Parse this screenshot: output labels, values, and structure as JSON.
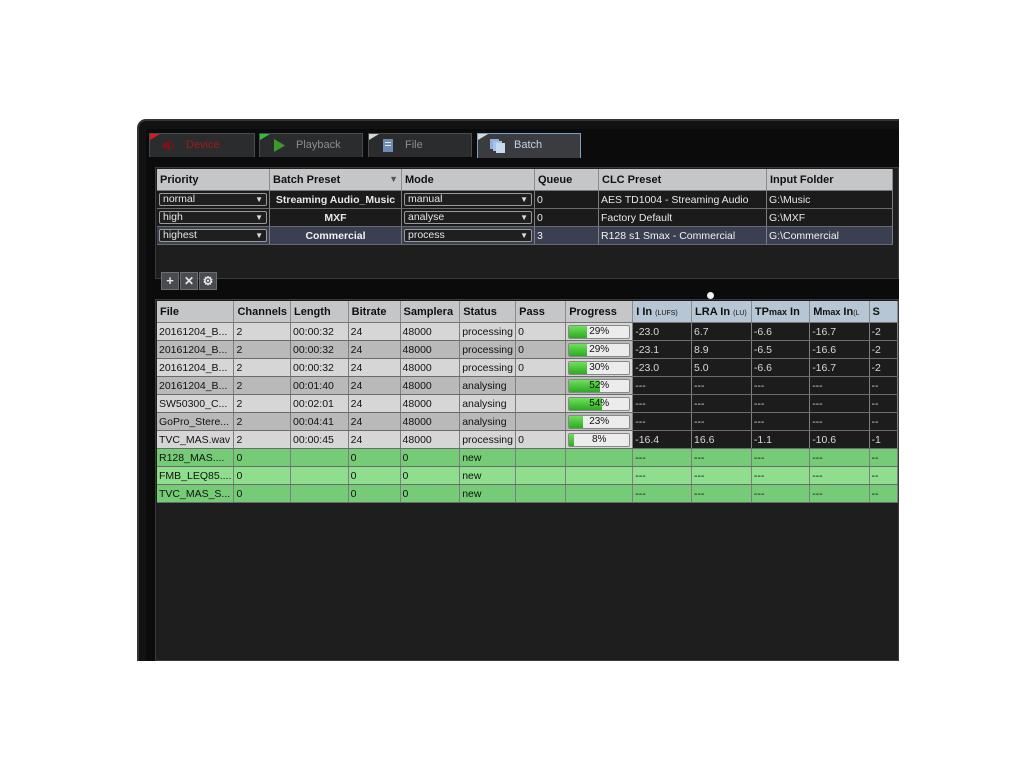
{
  "tabs": [
    {
      "label": "Device",
      "icon": "speaker-icon",
      "active": false
    },
    {
      "label": "Playback",
      "icon": "play-icon",
      "active": false
    },
    {
      "label": "File",
      "icon": "file-icon",
      "active": false
    },
    {
      "label": "Batch",
      "icon": "batch-icon",
      "active": true
    }
  ],
  "presets": {
    "columns": [
      "Priority",
      "Batch Preset",
      "Mode",
      "Queue",
      "CLC Preset",
      "Input Folder"
    ],
    "rows": [
      {
        "priority": "normal",
        "preset": "Streaming Audio_Music",
        "mode": "manual",
        "queue": "0",
        "clc": "AES TD1004 - Streaming Audio",
        "folder": "G:\\Music"
      },
      {
        "priority": "high",
        "preset": "MXF",
        "mode": "analyse",
        "queue": "0",
        "clc": "Factory Default",
        "folder": "G:\\MXF"
      },
      {
        "priority": "highest",
        "preset": "Commercial",
        "mode": "process",
        "queue": "3",
        "clc": "R128 s1 Smax - Commercial",
        "folder": "G:\\Commercial"
      }
    ],
    "buttons": {
      "add": "+",
      "remove": "✕",
      "settings": "⚙"
    }
  },
  "files": {
    "columns": {
      "file": "File",
      "channels": "Channels",
      "length": "Length",
      "bitrate": "Bitrate",
      "samplerate": "Samplera",
      "status": "Status",
      "pass": "Pass",
      "progress": "Progress",
      "i_in": "I In",
      "i_in_unit": "(LUFS)",
      "lra_in": "LRA In",
      "lra_unit": "(LU)",
      "tp_main": "TP",
      "tp_sub": "max",
      "tp_in": " In",
      "m_main": "M",
      "m_sub": "max",
      "m_in": " In",
      "m_unit": "(L",
      "s_main": "S"
    },
    "rows": [
      {
        "file": "20161204_B...",
        "channels": "2",
        "length": "00:00:32",
        "bitrate": "24",
        "samplerate": "48000",
        "status": "processing",
        "pass": "0",
        "progress": 0.29,
        "progress_label": "29%",
        "i_in": "-23.0",
        "lra": "6.7",
        "tp": "-6.6",
        "m": "-16.7",
        "s": "-2",
        "i_cls": "pos",
        "lra_cls": "pos",
        "tp_cls": "pos",
        "style": "gray-a"
      },
      {
        "file": "20161204_B...",
        "channels": "2",
        "length": "00:00:32",
        "bitrate": "24",
        "samplerate": "48000",
        "status": "processing",
        "pass": "0",
        "progress": 0.29,
        "progress_label": "29%",
        "i_in": "-23.1",
        "lra": "8.9",
        "tp": "-6.5",
        "m": "-16.6",
        "s": "-2",
        "i_cls": "pos",
        "lra_cls": "pos",
        "tp_cls": "pos",
        "style": "gray-b"
      },
      {
        "file": "20161204_B...",
        "channels": "2",
        "length": "00:00:32",
        "bitrate": "24",
        "samplerate": "48000",
        "status": "processing",
        "pass": "0",
        "progress": 0.3,
        "progress_label": "30%",
        "i_in": "-23.0",
        "lra": "5.0",
        "tp": "-6.6",
        "m": "-16.7",
        "s": "-2",
        "i_cls": "neg",
        "lra_cls": "pos",
        "tp_cls": "pos",
        "style": "gray-a"
      },
      {
        "file": "20161204_B...",
        "channels": "2",
        "length": "00:01:40",
        "bitrate": "24",
        "samplerate": "48000",
        "status": "analysing",
        "pass": "",
        "progress": 0.52,
        "progress_label": "52%",
        "i_in": "---",
        "lra": "---",
        "tp": "---",
        "m": "---",
        "s": "--",
        "i_cls": "",
        "lra_cls": "",
        "tp_cls": "",
        "style": "gray-b"
      },
      {
        "file": "SW50300_C...",
        "channels": "2",
        "length": "00:02:01",
        "bitrate": "24",
        "samplerate": "48000",
        "status": "analysing",
        "pass": "",
        "progress": 0.54,
        "progress_label": "54%",
        "i_in": "---",
        "lra": "---",
        "tp": "---",
        "m": "---",
        "s": "--",
        "i_cls": "",
        "lra_cls": "",
        "tp_cls": "",
        "style": "gray-a"
      },
      {
        "file": "GoPro_Stere...",
        "channels": "2",
        "length": "00:04:41",
        "bitrate": "24",
        "samplerate": "48000",
        "status": "analysing",
        "pass": "",
        "progress": 0.23,
        "progress_label": "23%",
        "i_in": "---",
        "lra": "---",
        "tp": "---",
        "m": "---",
        "s": "--",
        "i_cls": "",
        "lra_cls": "",
        "tp_cls": "",
        "style": "gray-b"
      },
      {
        "file": "TVC_MAS.wav",
        "channels": "2",
        "length": "00:00:45",
        "bitrate": "24",
        "samplerate": "48000",
        "status": "processing",
        "pass": "0",
        "progress": 0.08,
        "progress_label": "8%",
        "i_in": "-16.4",
        "lra": "16.6",
        "tp": "-1.1",
        "m": "-10.6",
        "s": "-1",
        "i_cls": "neg",
        "lra_cls": "neg",
        "tp_cls": "pos",
        "style": "gray-a"
      },
      {
        "file": "R128_MAS....",
        "channels": "0",
        "length": "",
        "bitrate": "0",
        "samplerate": "0",
        "status": "new",
        "pass": "",
        "progress": null,
        "progress_label": "",
        "i_in": "---",
        "lra": "---",
        "tp": "---",
        "m": "---",
        "s": "--",
        "i_cls": "",
        "lra_cls": "",
        "tp_cls": "",
        "style": "green-a"
      },
      {
        "file": "FMB_LEQ85....",
        "channels": "0",
        "length": "",
        "bitrate": "0",
        "samplerate": "0",
        "status": "new",
        "pass": "",
        "progress": null,
        "progress_label": "",
        "i_in": "---",
        "lra": "---",
        "tp": "---",
        "m": "---",
        "s": "--",
        "i_cls": "",
        "lra_cls": "",
        "tp_cls": "",
        "style": "green-b"
      },
      {
        "file": "TVC_MAS_S...",
        "channels": "0",
        "length": "",
        "bitrate": "0",
        "samplerate": "0",
        "status": "new",
        "pass": "",
        "progress": null,
        "progress_label": "",
        "i_in": "---",
        "lra": "---",
        "tp": "---",
        "m": "---",
        "s": "--",
        "i_cls": "",
        "lra_cls": "",
        "tp_cls": "",
        "style": "green-a"
      }
    ]
  }
}
